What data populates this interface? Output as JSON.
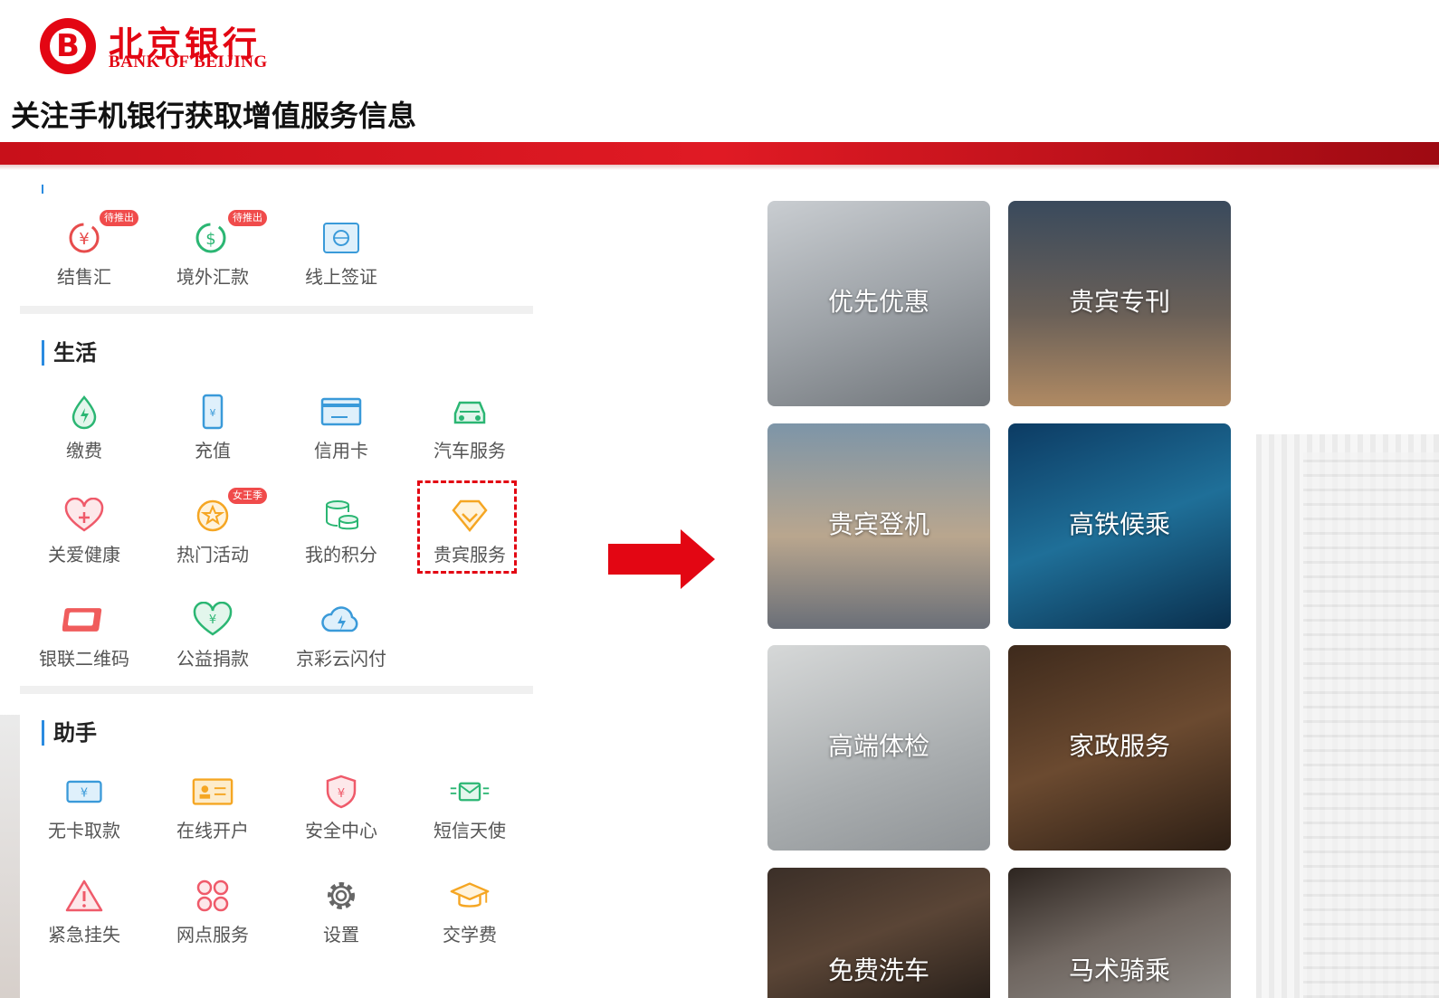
{
  "header": {
    "brand_cn": "北京银行",
    "brand_en": "BANK OF BEIJING",
    "title": "关注手机银行获取增值服务信息"
  },
  "sections": {
    "top_row": [
      {
        "label": "结售汇",
        "icon": "currency-exchange-icon",
        "badge": "待推出"
      },
      {
        "label": "境外汇款",
        "icon": "remittance-icon",
        "badge": "待推出"
      },
      {
        "label": "线上签证",
        "icon": "visa-icon"
      }
    ],
    "life": {
      "title": "生活",
      "items": [
        {
          "label": "缴费",
          "icon": "utility-payment-icon"
        },
        {
          "label": "充值",
          "icon": "phone-recharge-icon"
        },
        {
          "label": "信用卡",
          "icon": "credit-card-icon"
        },
        {
          "label": "汽车服务",
          "icon": "car-icon"
        },
        {
          "label": "关爱健康",
          "icon": "health-heart-icon"
        },
        {
          "label": "热门活动",
          "icon": "hot-event-icon",
          "badge": "女王季"
        },
        {
          "label": "我的积分",
          "icon": "points-icon"
        },
        {
          "label": "贵宾服务",
          "icon": "vip-diamond-icon"
        },
        {
          "label": "银联二维码",
          "icon": "unionpay-qr-icon"
        },
        {
          "label": "公益捐款",
          "icon": "charity-icon"
        },
        {
          "label": "京彩云闪付",
          "icon": "cloud-pay-icon"
        }
      ]
    },
    "assistant": {
      "title": "助手",
      "items": [
        {
          "label": "无卡取款",
          "icon": "cardless-withdraw-icon"
        },
        {
          "label": "在线开户",
          "icon": "open-account-icon"
        },
        {
          "label": "安全中心",
          "icon": "security-shield-icon"
        },
        {
          "label": "短信天使",
          "icon": "sms-icon"
        },
        {
          "label": "紧急挂失",
          "icon": "warning-icon"
        },
        {
          "label": "网点服务",
          "icon": "branch-grid-icon"
        },
        {
          "label": "设置",
          "icon": "gear-icon"
        },
        {
          "label": "交学费",
          "icon": "graduation-cap-icon"
        }
      ]
    }
  },
  "vip_tiles": [
    {
      "label": "优先优惠"
    },
    {
      "label": "贵宾专刊"
    },
    {
      "label": "贵宾登机"
    },
    {
      "label": "高铁候乘"
    },
    {
      "label": "高端体检"
    },
    {
      "label": "家政服务"
    },
    {
      "label": "免费洗车"
    },
    {
      "label": "马术骑乘"
    }
  ],
  "colors": {
    "brand_red": "#e30613",
    "accent_blue": "#2a8be0"
  }
}
